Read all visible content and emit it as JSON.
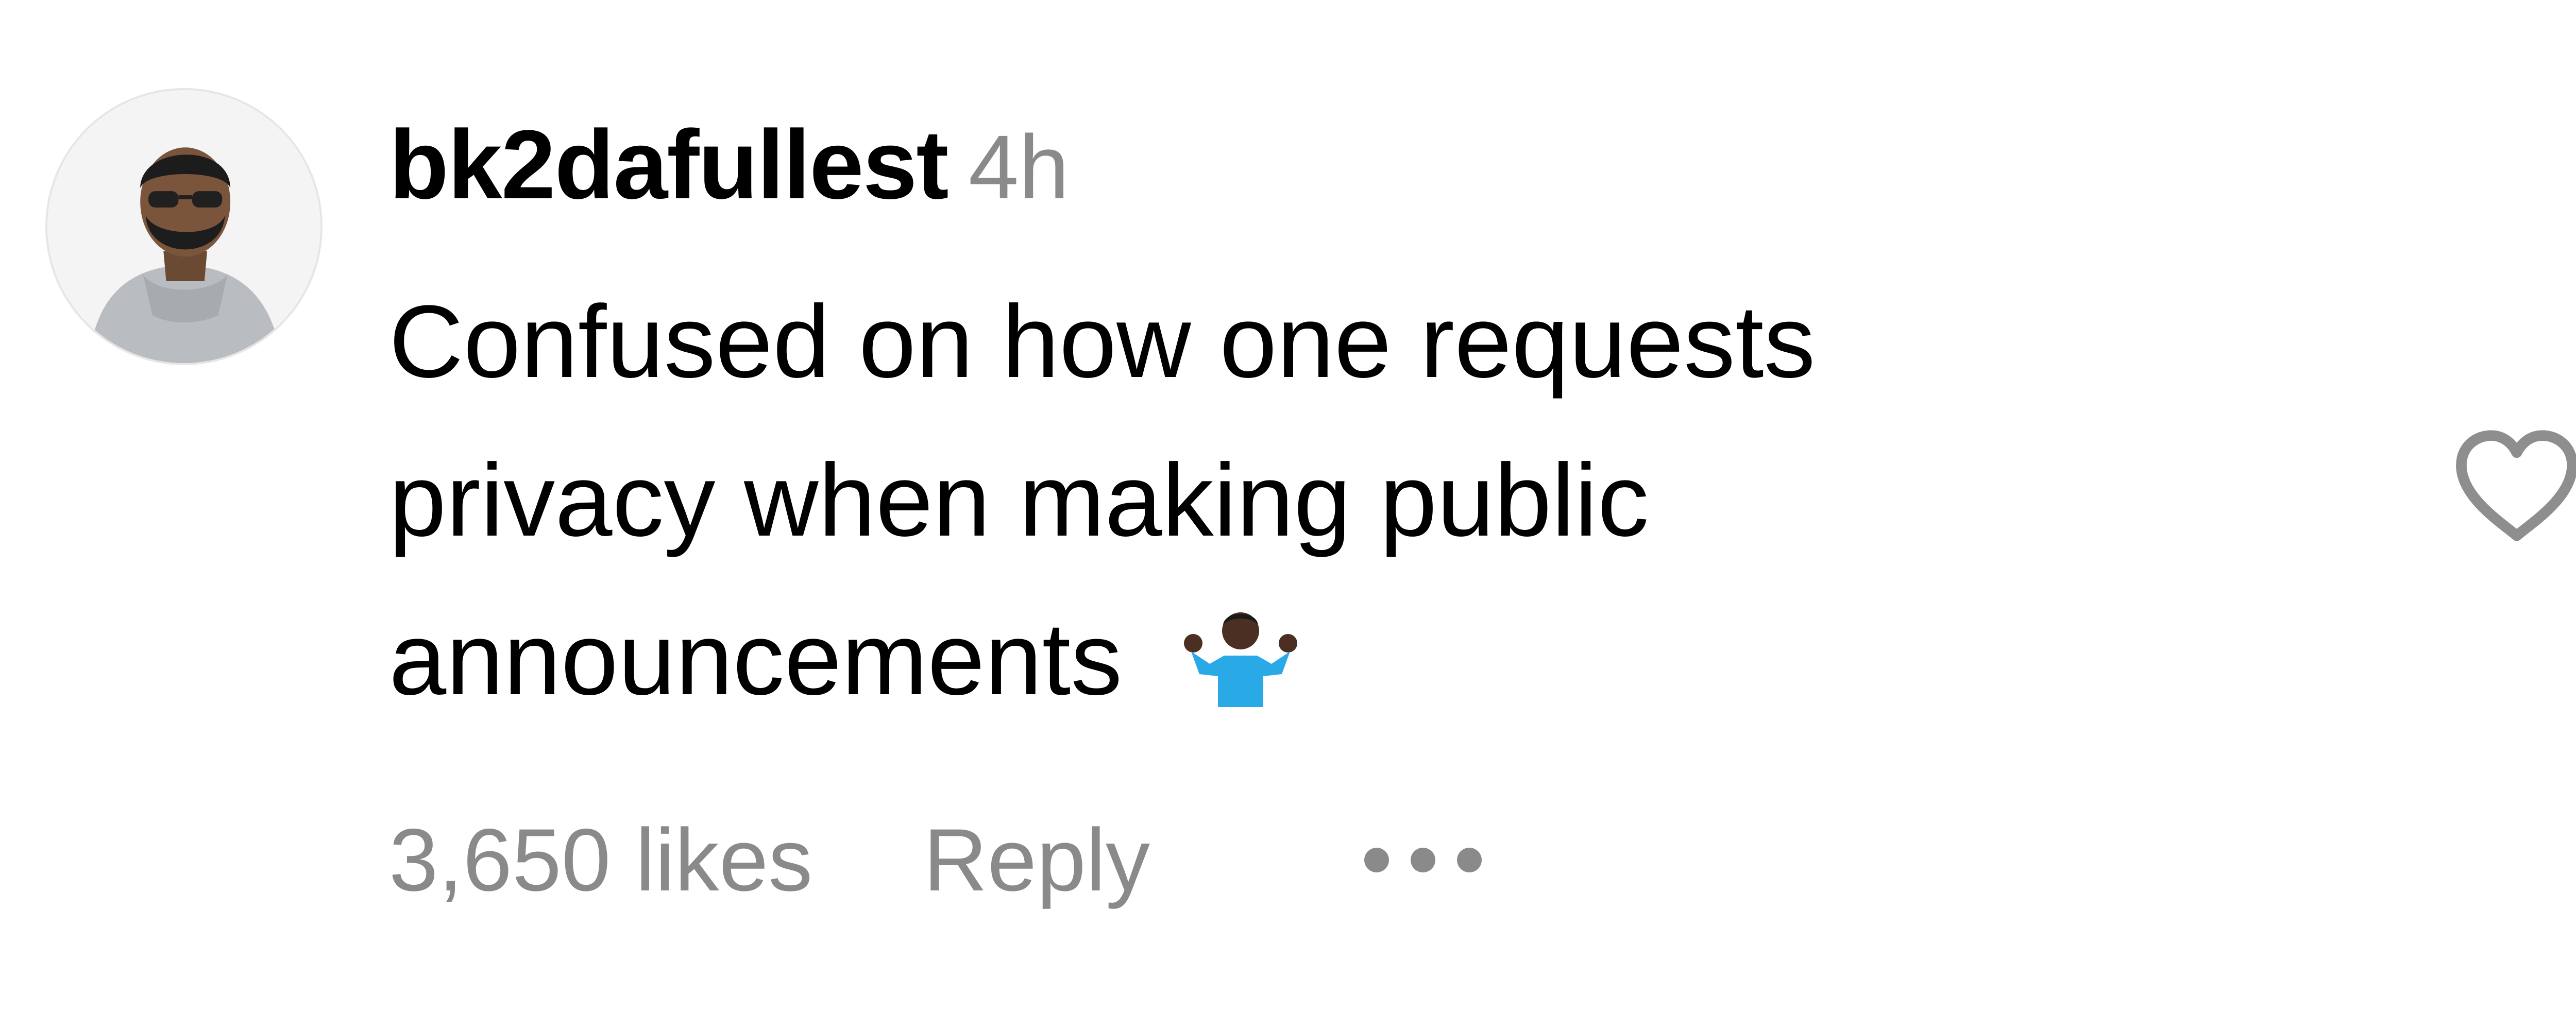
{
  "comment": {
    "username": "bk2dafullest",
    "timestamp": "4h",
    "text_lines": [
      "Confused on how one requests",
      "privacy when making public",
      "announcements"
    ],
    "emoji": "🤷🏿‍♂️",
    "likes_label": "3,650 likes",
    "reply_label": "Reply",
    "more_icon": "more-options-icon",
    "like_icon": "heart-outline-icon",
    "avatar_icon": "user-avatar"
  },
  "colors": {
    "text": "#000000",
    "secondary_text": "#8a8a8a",
    "heart_outline": "#8e8e8e"
  }
}
